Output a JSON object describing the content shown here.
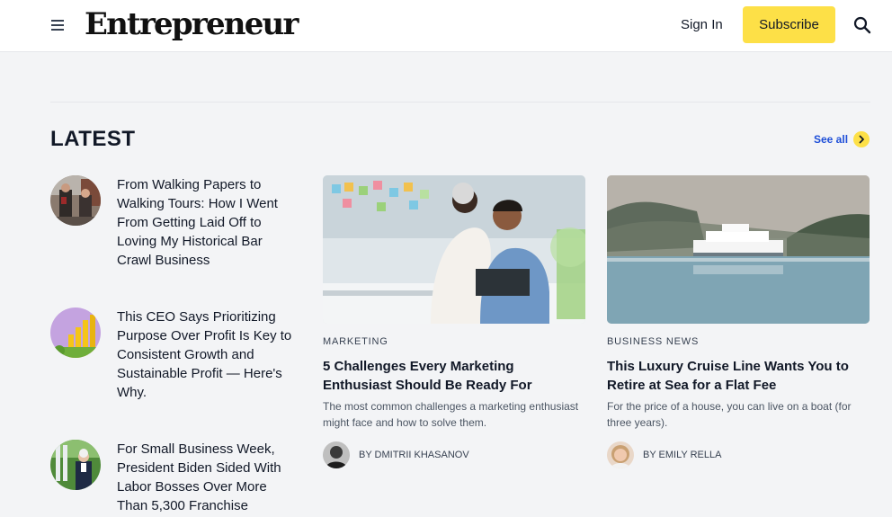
{
  "header": {
    "logo_text": "Entrepreneur",
    "sign_in_label": "Sign In",
    "subscribe_label": "Subscribe",
    "subscribe_color": "#fde047",
    "icons": [
      "menu-icon",
      "search-icon"
    ]
  },
  "latest": {
    "title": "LATEST",
    "see_all_label": "See all",
    "accent_color": "#1d4ed8"
  },
  "list_items": [
    {
      "title": "From Walking Papers to Walking Tours: How I Went From Getting Laid Off to Loving My Historical Bar Crawl Business"
    },
    {
      "title": "This CEO Says Prioritizing Purpose Over Profit Is Key to Consistent Growth and Sustainable Profit — Here's Why."
    },
    {
      "title": "For Small Business Week, President Biden Sided With Labor Bosses Over More Than 5,300 Franchise"
    }
  ],
  "cards": [
    {
      "category": "MARKETING",
      "title": "5 Challenges Every Marketing Enthusiast Should Be Ready For",
      "description": "The most common challenges a marketing enthusiast might face and how to solve them.",
      "author": "BY DMITRII KHASANOV"
    },
    {
      "category": "BUSINESS NEWS",
      "title": "This Luxury Cruise Line Wants You to Retire at Sea for a Flat Fee",
      "description": "For the price of a house, you can live on a boat (for three years).",
      "author": "BY EMILY RELLA"
    }
  ]
}
